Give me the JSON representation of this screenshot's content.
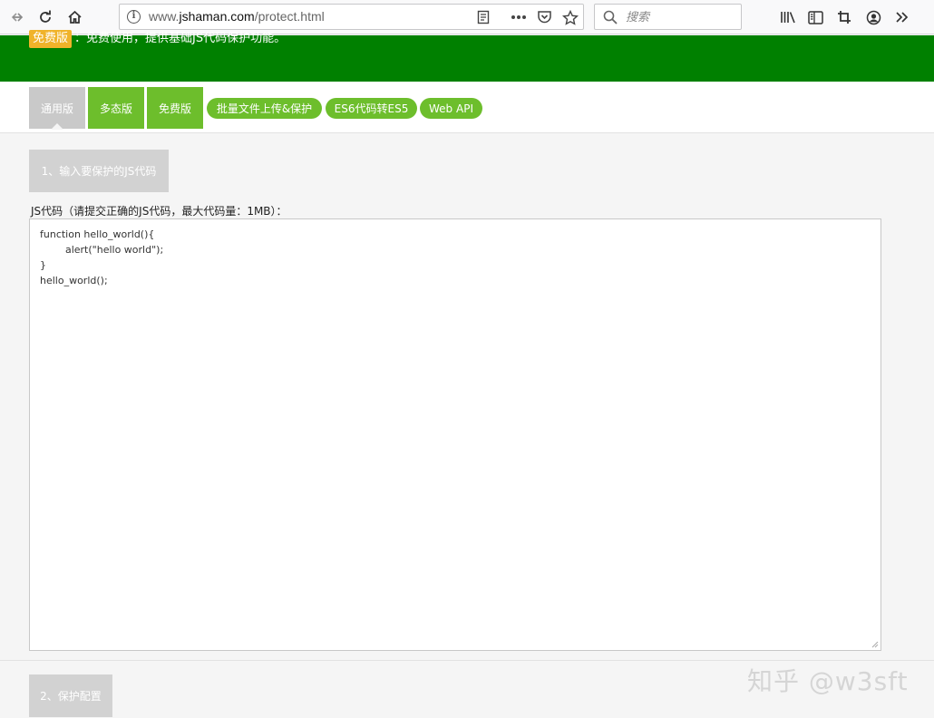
{
  "browser": {
    "url_prefix": "www.",
    "url_domain": "jshaman.com",
    "url_path": "/protect.html",
    "search_placeholder": "搜索"
  },
  "header": {
    "badge": "免费版",
    "description": "：免费使用，提供基础JS代码保护功能。"
  },
  "tabs": [
    {
      "label": "通用版",
      "active": true
    },
    {
      "label": "多态版"
    },
    {
      "label": "免费版"
    },
    {
      "label": "批量文件上传&保护"
    },
    {
      "label": "ES6代码转ES5"
    },
    {
      "label": "Web API"
    }
  ],
  "step1": {
    "label": "1、输入要保护的JS代码"
  },
  "code": {
    "label": "JS代码（请提交正确的JS代码，最大代码量：1MB）：",
    "value": "function hello_world(){\n        alert(\"hello world\");\n}\nhello_world();"
  },
  "step2": {
    "label": "2、保护配置"
  },
  "watermark": "知乎 @w3sft",
  "colors": {
    "green": "#008000",
    "tab_green": "#6dbe2c",
    "badge": "#f0b32a"
  }
}
